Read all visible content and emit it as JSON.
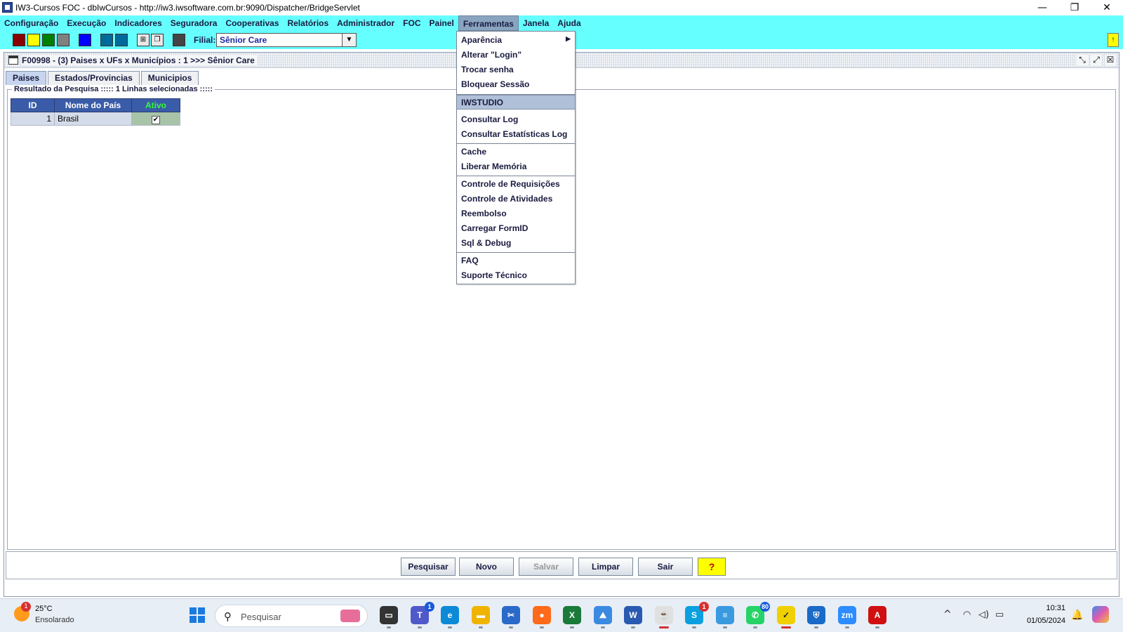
{
  "window": {
    "title": "IW3-Cursos FOC - dbIwCursos - http://iw3.iwsoftware.com.br:9090/Dispatcher/BridgeServlet",
    "minimize": "—",
    "restore": "❐",
    "close": "✕"
  },
  "menubar": {
    "items": [
      "Configuração",
      "Execução",
      "Indicadores",
      "Seguradora",
      "Cooperativas",
      "Relatórios",
      "Administrador",
      "FOC",
      "Painel",
      "Ferramentas",
      "Janela",
      "Ajuda"
    ],
    "active": "Ferramentas"
  },
  "toolbar": {
    "swatch_colors": [
      "#8b0000",
      "#ffff00",
      "#008000",
      "#808080",
      "#0000ff",
      "#006b9a",
      "#006b9a"
    ],
    "filial_label": "Filial:",
    "filial_value": "Sênior Care",
    "warning_badge": "!"
  },
  "frame": {
    "title": "F00998 - (3) Paises x UFs x Municípios : 1 >>> Sênior Care",
    "tabs": [
      "Paises",
      "Estados/Provincias",
      "Municipios"
    ],
    "active_tab": "Paises",
    "results_legend": "Resultado da Pesquisa ::::: 1 Linhas selecionadas :::::",
    "grid": {
      "columns": [
        "ID",
        "Nome do País",
        "Ativo"
      ],
      "rows": [
        {
          "id": "1",
          "nome": "Brasil",
          "ativo": true
        }
      ]
    },
    "buttons": {
      "pesquisar": "Pesquisar",
      "novo": "Novo",
      "salvar": "Salvar",
      "limpar": "Limpar",
      "sair": "Sair",
      "help": "?"
    }
  },
  "ferramentas_menu": {
    "items": [
      "Aparência",
      "Alterar \"Login\"",
      "Trocar senha",
      "Bloquear Sessão",
      "IWSTUDIO",
      "Consultar Log",
      "Consultar Estatísticas Log",
      "Cache",
      "Liberar Memória",
      "Controle de Requisições",
      "Controle de Atividades",
      "Reembolso",
      "Carregar FormID",
      "Sql & Debug",
      "FAQ",
      "Suporte Técnico"
    ],
    "highlighted": "IWSTUDIO",
    "submenu_arrow": "▶"
  },
  "taskbar": {
    "weather_temp": "25°C",
    "weather_condition": "Ensolarado",
    "weather_badge": "1",
    "search_placeholder": "Pesquisar",
    "apps": [
      {
        "name": "task-view",
        "label": "▭",
        "color": "#333333"
      },
      {
        "name": "teams",
        "label": "T",
        "color": "#5059c9",
        "badge": "1",
        "badge_color": "blue"
      },
      {
        "name": "edge",
        "label": "e",
        "color": "#0c8ad8"
      },
      {
        "name": "file-explorer",
        "label": "▬",
        "color": "#f0b400"
      },
      {
        "name": "snipping-tool",
        "label": "✂",
        "color": "#2a6ac8"
      },
      {
        "name": "firefox",
        "label": "●",
        "color": "#ff6a1a"
      },
      {
        "name": "excel",
        "label": "X",
        "color": "#1a7a3a"
      },
      {
        "name": "photos",
        "label": "⛰",
        "color": "#3a8ae0"
      },
      {
        "name": "word",
        "label": "W",
        "color": "#2a5ab0"
      },
      {
        "name": "java",
        "label": "☕",
        "color": "#e0e0e0"
      },
      {
        "name": "skype",
        "label": "S",
        "color": "#0aa0e0",
        "badge": "1",
        "badge_color": "red"
      },
      {
        "name": "notepad",
        "label": "≡",
        "color": "#3a9ae0"
      },
      {
        "name": "whatsapp",
        "label": "✆",
        "color": "#25d366",
        "badge": "80",
        "badge_color": "blue"
      },
      {
        "name": "tasks",
        "label": "✓",
        "color": "#f0d000"
      },
      {
        "name": "security",
        "label": "⛨",
        "color": "#1a6ac8"
      },
      {
        "name": "zoom",
        "label": "zm",
        "color": "#2d8cff"
      },
      {
        "name": "acrobat",
        "label": "A",
        "color": "#d01010"
      }
    ],
    "clock_time": "10:31",
    "clock_date": "01/05/2024"
  }
}
